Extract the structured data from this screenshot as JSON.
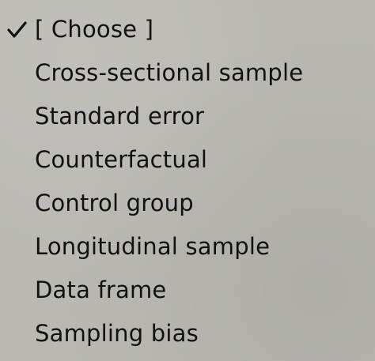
{
  "dropdown": {
    "selected_index": 0,
    "items": [
      {
        "label": "[ Choose ]",
        "selected": true
      },
      {
        "label": "Cross-sectional sample",
        "selected": false
      },
      {
        "label": "Standard error",
        "selected": false
      },
      {
        "label": "Counterfactual",
        "selected": false
      },
      {
        "label": "Control group",
        "selected": false
      },
      {
        "label": "Longitudinal sample",
        "selected": false
      },
      {
        "label": "Data frame",
        "selected": false
      },
      {
        "label": "Sampling bias",
        "selected": false
      }
    ]
  },
  "icons": {
    "selected_marker": "checkmark-icon"
  },
  "colors": {
    "background": "#b9b8b3",
    "text": "#111111"
  }
}
